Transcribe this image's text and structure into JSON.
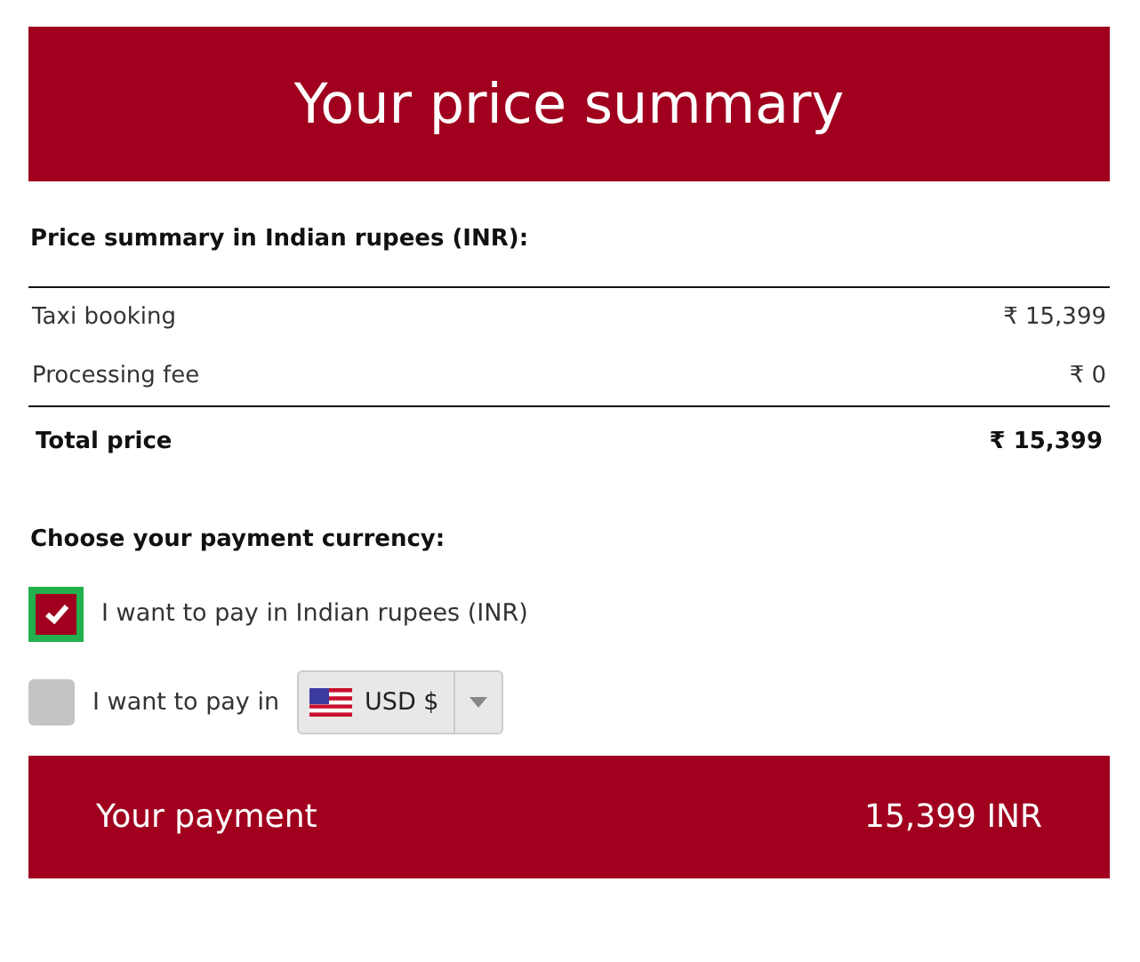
{
  "header": {
    "title": "Your price summary"
  },
  "summary": {
    "heading": "Price summary in Indian rupees (INR):",
    "rows": [
      {
        "label": "Taxi booking",
        "amount": "₹ 15,399",
        "kind": "line"
      },
      {
        "label": "Processing fee",
        "amount": "₹ 0",
        "kind": "line"
      },
      {
        "label": "Total price",
        "amount": "₹ 15,399",
        "kind": "total"
      }
    ]
  },
  "currency": {
    "heading": "Choose your payment currency:",
    "options": [
      {
        "label": "I want to pay in Indian rupees (INR)",
        "checked": true,
        "focused": true
      },
      {
        "label": "I want to pay in",
        "checked": false,
        "focused": false,
        "select": {
          "value": "USD $"
        }
      }
    ]
  },
  "payment": {
    "label": "Your payment",
    "amount": "15,399 INR"
  }
}
